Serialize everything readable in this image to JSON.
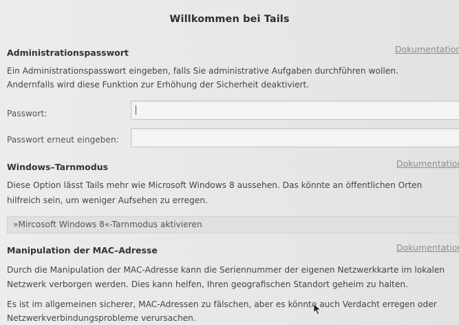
{
  "window": {
    "title": "Willkommen bei Tails"
  },
  "admin_password": {
    "heading": "Administrationspasswort",
    "doc_link": "Dokumentation",
    "description_line1": "Ein Administrationspasswort eingeben, falls Sie administrative Aufgaben durchführen wollen.",
    "description_line2": "Andernfalls wird diese Funktion zur Erhöhung der Sicherheit deaktiviert.",
    "password_label": "Passwort:",
    "password_value": "",
    "confirm_label": "Passwort erneut eingeben:",
    "confirm_value": ""
  },
  "windows_camouflage": {
    "heading": "Windows–Tarnmodus",
    "doc_link": "Dokumentation",
    "description_line1": "Diese Option lässt Tails mehr wie Microsoft Windows 8 aussehen. Das könnte an öffentlichen Orten",
    "description_line2": "hilfreich sein, um weniger Aufsehen zu erregen.",
    "toggle_label": "»Mircosoft Windows 8«-Tarnmodus aktivieren"
  },
  "mac_spoofing": {
    "heading": "Manipulation der MAC–Adresse",
    "doc_link": "Dokumentation",
    "description_line1": "Durch die Manipulation der MAC-Adresse kann die Seriennummer der eigenen Netzwerkkarte im lokalen",
    "description_line2": "Netzwerk verborgen werden. Dies kann helfen, Ihren geografischen Standort geheim zu halten.",
    "note_line1": "Es ist im allgemeinen sicherer, MAC-Adressen zu fälschen, aber es könnte auch Verdacht erregen oder",
    "note_line2": "Netzwerkverbindungsprobleme verursachen."
  },
  "icons": {
    "cursor": "mouse-pointer-icon"
  }
}
